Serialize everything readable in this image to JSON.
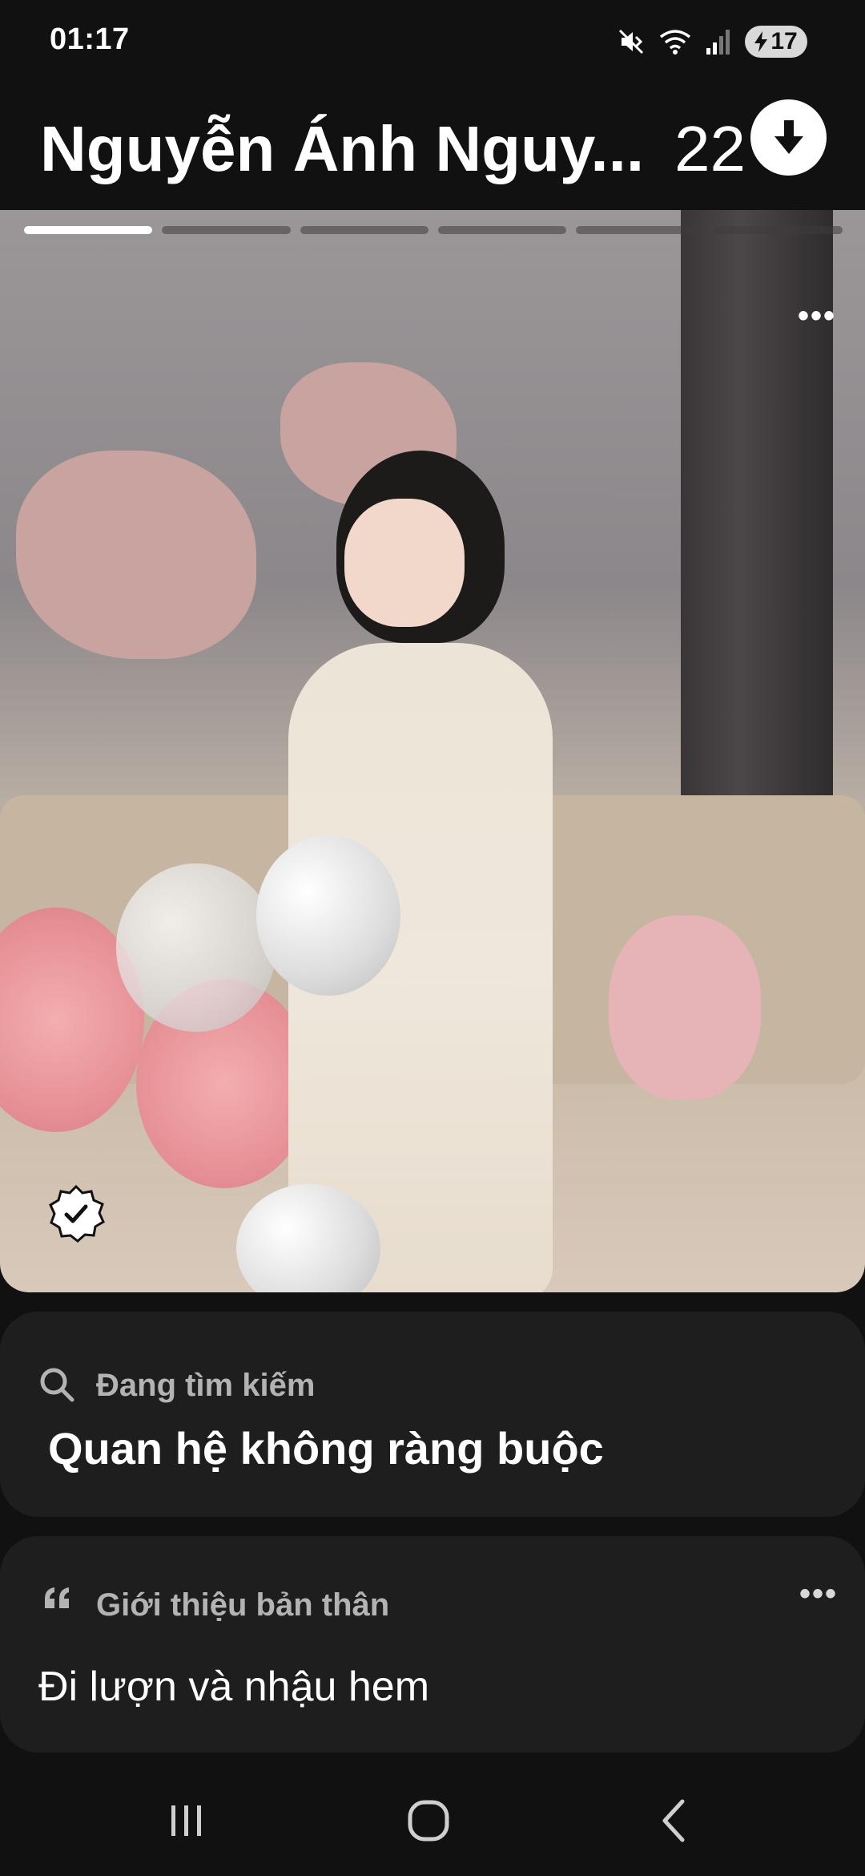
{
  "status_bar": {
    "time": "01:17",
    "battery_level": "17",
    "icons": [
      "mute-icon",
      "wifi-icon",
      "signal-icon",
      "battery-icon"
    ]
  },
  "header": {
    "name": "Nguyễn Ánh Nguy...",
    "age": "22",
    "download_icon": "arrow-down-icon"
  },
  "photo": {
    "progress_segments": 6,
    "active_segment": 1,
    "menu_label": "•••",
    "verified_icon": "verified-badge-icon"
  },
  "looking_for": {
    "label": "Đang tìm kiếm",
    "value": "Quan hệ không ràng buộc",
    "icon": "search-icon"
  },
  "bio": {
    "label": "Giới thiệu bản thân",
    "value": "Đi lượn và nhậu hem",
    "icon": "quote-icon",
    "menu_label": "•••"
  },
  "navbar": {
    "items": [
      "recent-apps-icon",
      "home-icon",
      "back-icon"
    ]
  },
  "colors": {
    "background": "#111111",
    "card": "#1e1e1e",
    "label_gray": "#b3b3b3"
  }
}
